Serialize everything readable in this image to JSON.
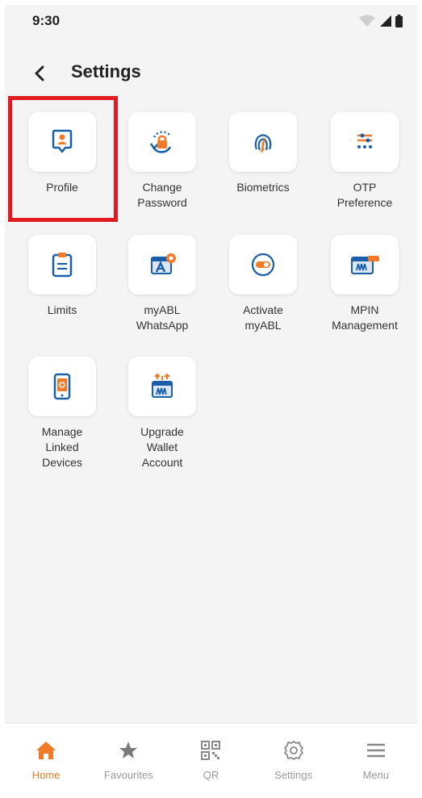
{
  "status_bar": {
    "time": "9:30"
  },
  "header": {
    "title": "Settings"
  },
  "tiles": [
    {
      "label": "Profile"
    },
    {
      "label": "Change\nPassword"
    },
    {
      "label": "Biometrics"
    },
    {
      "label": "OTP\nPreference"
    },
    {
      "label": "Limits"
    },
    {
      "label": "myABL\nWhatsApp"
    },
    {
      "label": "Activate\nmyABL"
    },
    {
      "label": "MPIN\nManagement"
    },
    {
      "label": "Manage\nLinked\nDevices"
    },
    {
      "label": "Upgrade\nWallet\nAccount"
    }
  ],
  "bottom_nav": [
    {
      "label": "Home",
      "icon": "home-icon",
      "active": true
    },
    {
      "label": "Favourites",
      "icon": "star-icon",
      "active": false
    },
    {
      "label": "QR",
      "icon": "qr-icon",
      "active": false
    },
    {
      "label": "Settings",
      "icon": "gear-icon",
      "active": false
    },
    {
      "label": "Menu",
      "icon": "hamburger-icon",
      "active": false
    }
  ],
  "colors": {
    "accent": "#f07a28",
    "icon_blue": "#1a5fa8",
    "highlight": "#e11b22",
    "inactive": "#999999"
  }
}
